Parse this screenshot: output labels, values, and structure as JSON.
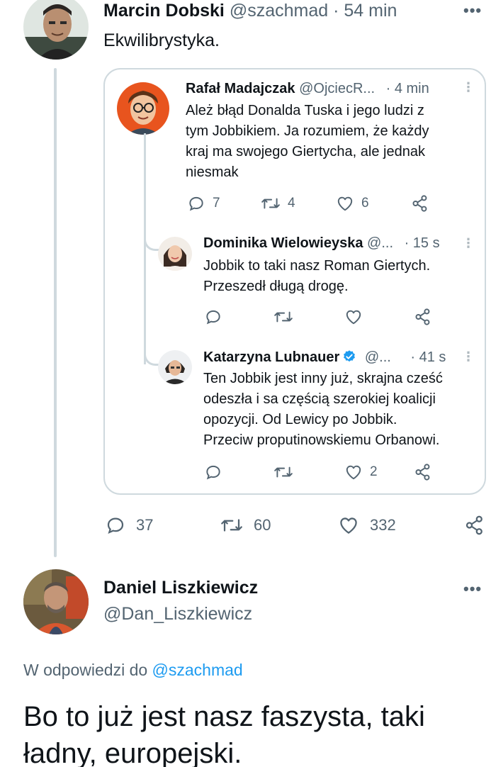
{
  "main_tweet": {
    "author_name": "Marcin Dobski",
    "handle": "@szachmad",
    "separator": "·",
    "time": "54 min",
    "text": "Ekwilibrystyka.",
    "more_icon": "more-horizontal-icon",
    "actions": {
      "replies": "37",
      "retweets": "60",
      "likes": "332"
    }
  },
  "quoted_thread": {
    "tweets": [
      {
        "author_name": "Rafał Madajczak",
        "handle": "@OjciecR...",
        "time": "· 4 min",
        "text_lines": [
          "Ależ błąd Donalda Tuska i jego ludzi z",
          "tym Jobbikiem. Ja rozumiem, że każdy",
          "kraj ma swojego Giertycha, ale jednak",
          "niesmak"
        ],
        "replies": "7",
        "retweets": "4",
        "likes": "6"
      },
      {
        "author_name": "Dominika Wielowieyska",
        "handle": "@...",
        "time": "· 15 s",
        "text_lines": [
          "Jobbik to taki nasz Roman Giertych.",
          "Przeszedł długą drogę."
        ],
        "replies": "",
        "retweets": "",
        "likes": ""
      },
      {
        "author_name": "Katarzyna Lubnauer",
        "verified": true,
        "handle": "@...",
        "time": "· 41 s",
        "text_lines": [
          "Ten Jobbik jest inny już, skrajna cześć",
          "odeszła i sa częścią szerokiej koalicji",
          "opozycji. Od Lewicy po Jobbik.",
          "Przeciw proputinowskiemu Orbanowi."
        ],
        "replies": "",
        "retweets": "",
        "likes": "2"
      }
    ]
  },
  "reply_tweet": {
    "author_name": "Daniel Liszkiewicz",
    "handle": "@Dan_Liszkiewicz",
    "reply_prefix": "W odpowiedzi do",
    "reply_to": "@szachmad",
    "text": "Bo to już jest nasz faszysta, taki ładny, europejski."
  },
  "colors": {
    "text": "#0f1419",
    "secondary": "#536471",
    "link": "#1d9bf0",
    "border": "#cfd9de"
  }
}
